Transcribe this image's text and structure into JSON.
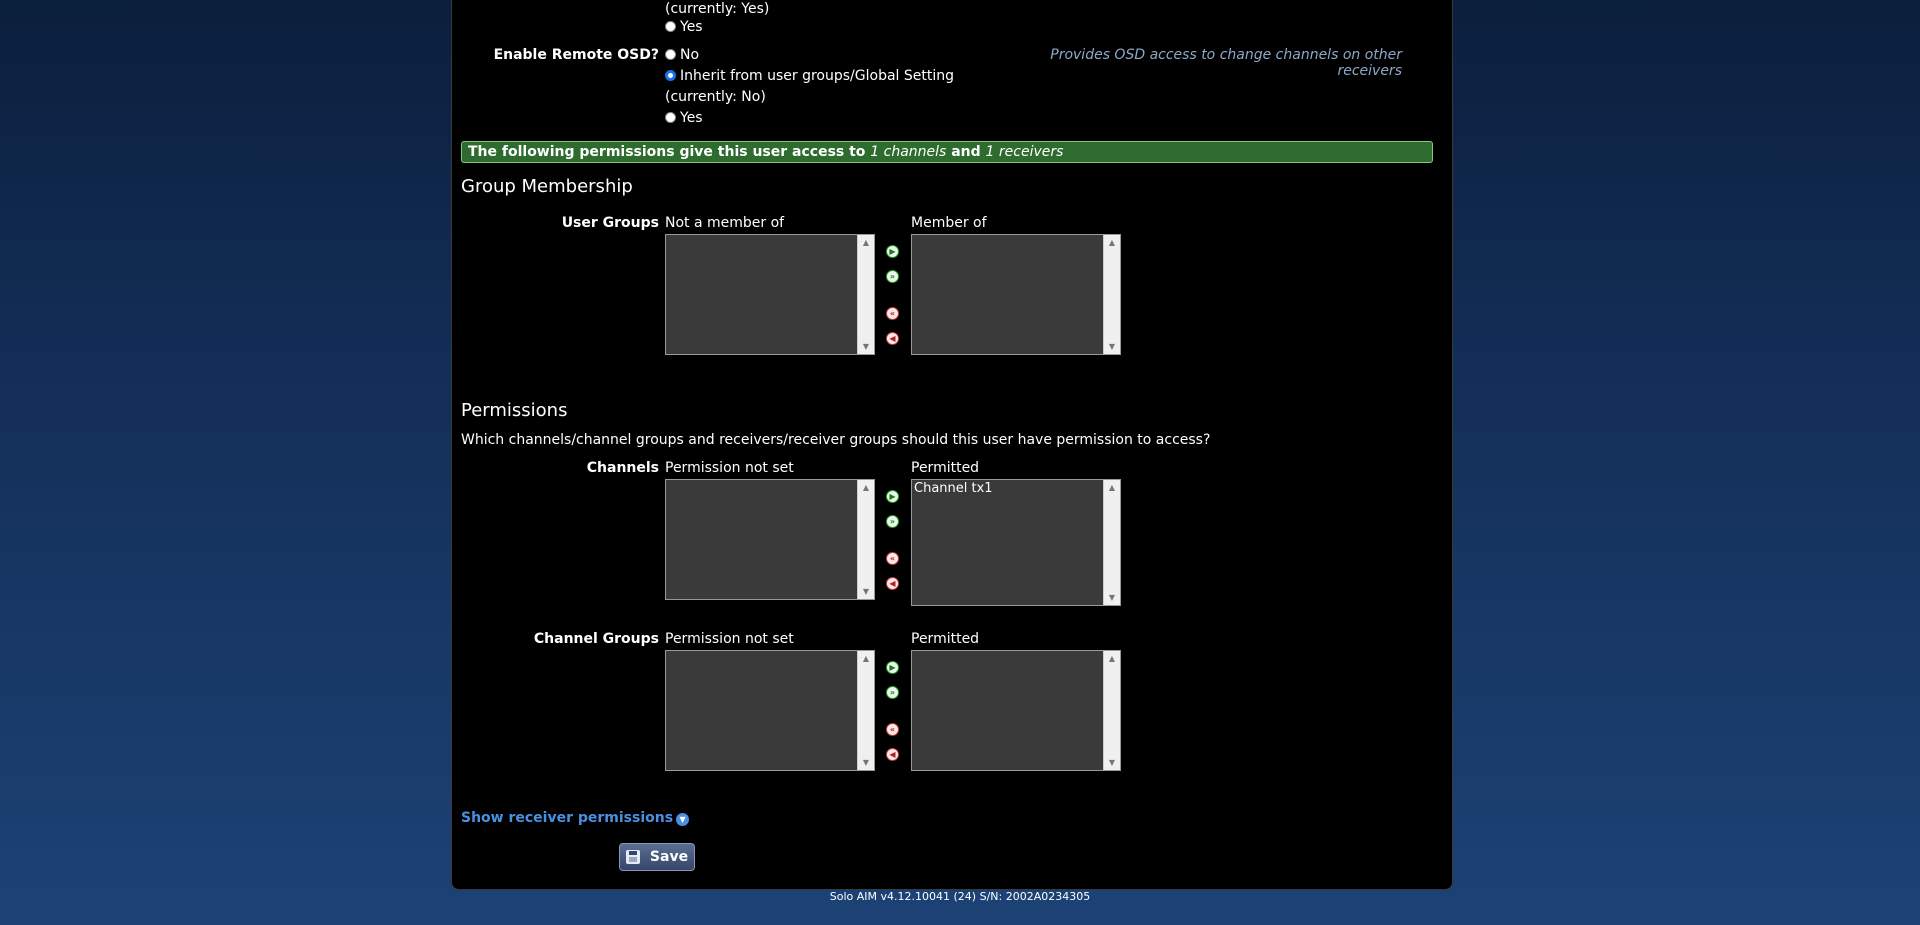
{
  "osd_prev": {
    "currently": "(currently: Yes)",
    "yes": "Yes"
  },
  "remote_osd": {
    "label": "Enable Remote OSD?",
    "no": "No",
    "inherit": "Inherit from user groups/Global Setting",
    "currently": "(currently: No)",
    "yes": "Yes",
    "selected": "inherit",
    "note": "Provides OSD access to change channels on other receivers"
  },
  "banner": {
    "prefix": "The following permissions give this user access to",
    "channels": "1 channels",
    "and": "and",
    "receivers": "1 receivers"
  },
  "group_membership": {
    "heading": "Group Membership",
    "row_label": "User Groups",
    "left_header": "Not a member of",
    "right_header": "Member of",
    "left_items": [],
    "right_items": []
  },
  "permissions": {
    "heading": "Permissions",
    "question": "Which channels/channel groups and receivers/receiver groups should this user have permission to access?",
    "channels": {
      "label": "Channels",
      "left_header": "Permission not set",
      "right_header": "Permitted",
      "left_items": [],
      "right_items": [
        "Channel tx1"
      ]
    },
    "channel_groups": {
      "label": "Channel Groups",
      "left_header": "Permission not set",
      "right_header": "Permitted",
      "left_items": [],
      "right_items": []
    }
  },
  "show_receiver_link": "Show receiver permissions",
  "save_label": "Save",
  "footer": "Solo AIM v4.12.10041 (24)  S/N: 2002A0234305",
  "colors": {
    "banner_bg": "#2e6b2e",
    "link": "#4a90e2",
    "add_button": "#2a9a2a",
    "remove_button": "#c23a3a"
  }
}
